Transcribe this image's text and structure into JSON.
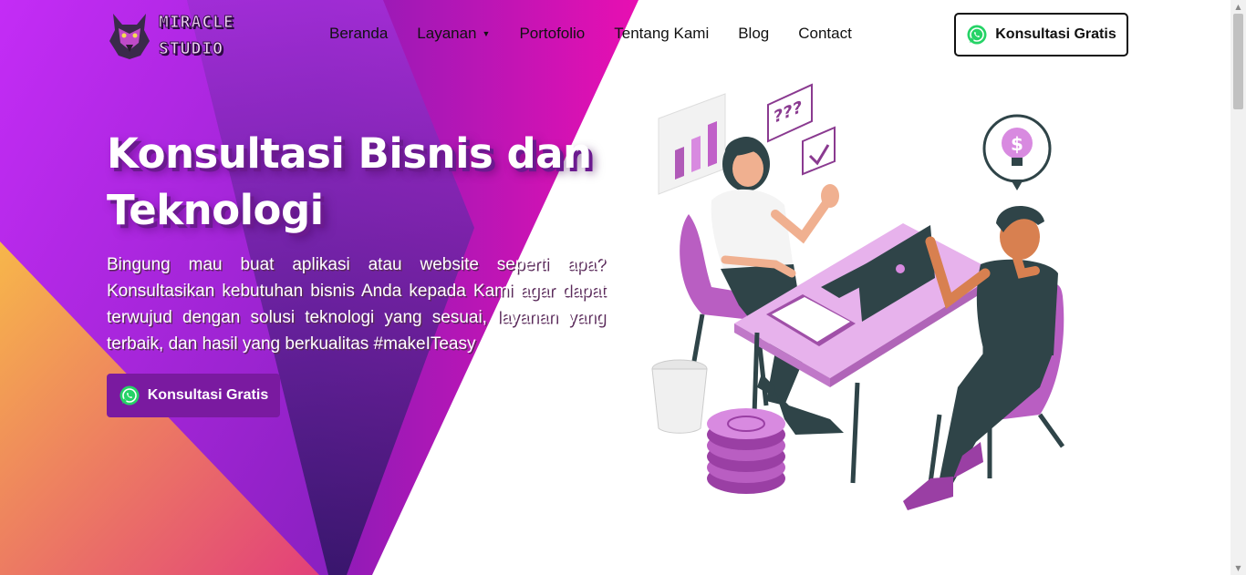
{
  "brand": {
    "name_line1": "MIRACLE",
    "name_line2": "STUDIO",
    "logo_icon": "wolf-logo-icon"
  },
  "nav": {
    "items": [
      {
        "label": "Beranda"
      },
      {
        "label": "Layanan",
        "has_dropdown": true
      },
      {
        "label": "Portofolio"
      },
      {
        "label": "Tentang Kami"
      },
      {
        "label": "Blog"
      },
      {
        "label": "Contact"
      }
    ],
    "cta_label": "Konsultasi Gratis",
    "cta_icon": "whatsapp-icon"
  },
  "hero": {
    "title": "Konsultasi Bisnis dan Teknologi",
    "description": "Bingung mau buat aplikasi atau website seperti apa? Konsultasikan kebutuhan bisnis Anda kepada Kami agar dapat terwujud dengan solusi teknologi yang sesuai, layanan yang terbaik, dan hasil yang berkualitas #makeITeasy",
    "button_label": "Konsultasi Gratis",
    "button_icon": "whatsapp-icon"
  },
  "illustration": {
    "question_text": "???",
    "dollar_symbol": "$",
    "icon": "business-consultation-illustration"
  },
  "colors": {
    "primary": "#7a1aa0",
    "magenta": "#e010b0",
    "violet": "#b030f0",
    "orange": "#f48a3a",
    "illustration_pink": "#d88ae0",
    "illustration_dark": "#2f4448",
    "whatsapp_green": "#25d366"
  }
}
